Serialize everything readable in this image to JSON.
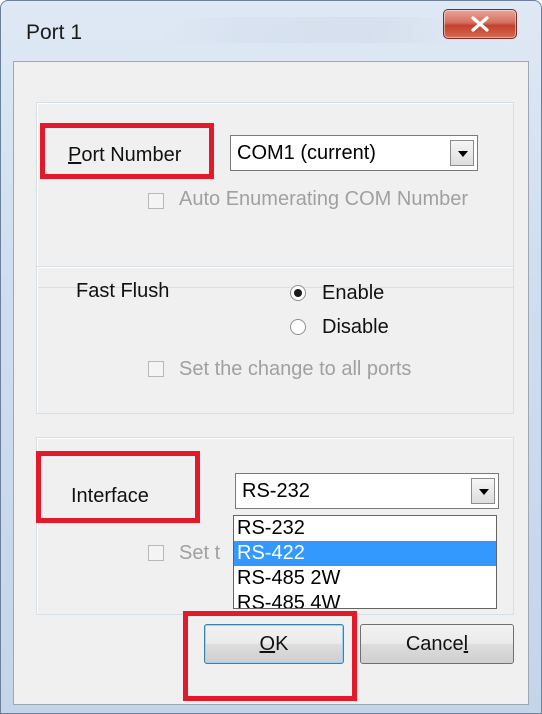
{
  "window": {
    "title": "Port 1"
  },
  "port_group": {
    "port_number_label": "Port Number",
    "port_combo_value": "COM1 (current)",
    "auto_enumerating_label": "Auto Enumerating COM Number"
  },
  "flush_group": {
    "fast_flush_label": "Fast Flush",
    "enable_label": "Enable",
    "disable_label": "Disable",
    "set_all_label": "Set the change to all ports"
  },
  "interface_group": {
    "interface_label": "Interface",
    "interface_combo_value": "RS-232",
    "partial_set_label": "Set t",
    "options": [
      "RS-232",
      "RS-422",
      "RS-485 2W",
      "RS-485 4W"
    ],
    "highlighted_option": "RS-422"
  },
  "buttons": {
    "ok_label": "OK",
    "cancel_label": "Cancel"
  },
  "colors": {
    "highlight_box": "#e21a2a",
    "selection": "#3399ff",
    "close_button": "#c2412c"
  }
}
